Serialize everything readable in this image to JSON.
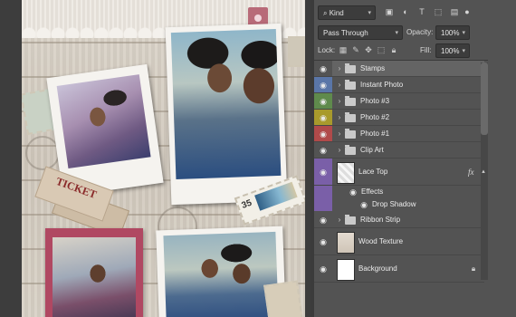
{
  "panel": {
    "filter": {
      "kind_label": "Kind"
    },
    "blend": {
      "mode": "Pass Through",
      "opacity_label": "Opacity:",
      "opacity_value": "100%"
    },
    "lock": {
      "lock_label": "Lock:",
      "fill_label": "Fill:",
      "fill_value": "100%"
    },
    "layers": [
      {
        "name": "Stamps",
        "type": "group",
        "color": "#535353",
        "selected": true
      },
      {
        "name": "Instant Photo",
        "type": "group",
        "color": "#5a76a8"
      },
      {
        "name": "Photo #3",
        "type": "group",
        "color": "#5f8a4c"
      },
      {
        "name": "Photo #2",
        "type": "group",
        "color": "#a89a2c"
      },
      {
        "name": "Photo #1",
        "type": "group",
        "color": "#b04a4a"
      },
      {
        "name": "Clip Art",
        "type": "group",
        "color": "#535353"
      },
      {
        "name": "Lace Top",
        "type": "layer",
        "color": "#7a5fa8",
        "fx": "fx"
      },
      {
        "name": "Effects",
        "type": "effects"
      },
      {
        "name": "Drop Shadow",
        "type": "effect"
      },
      {
        "name": "Ribbon Strip",
        "type": "group",
        "color": "#535353"
      },
      {
        "name": "Wood Texture",
        "type": "layer"
      },
      {
        "name": "Background",
        "type": "layer"
      }
    ]
  },
  "canvas": {
    "ticket_text": "TICKET"
  },
  "colors": {
    "panel_bg": "#535353",
    "selected_row": "#646464",
    "label_blue": "#5a76a8",
    "label_green": "#5f8a4c",
    "label_yellow": "#a89a2c",
    "label_red": "#b04a4a",
    "label_violet": "#7a5fa8"
  }
}
